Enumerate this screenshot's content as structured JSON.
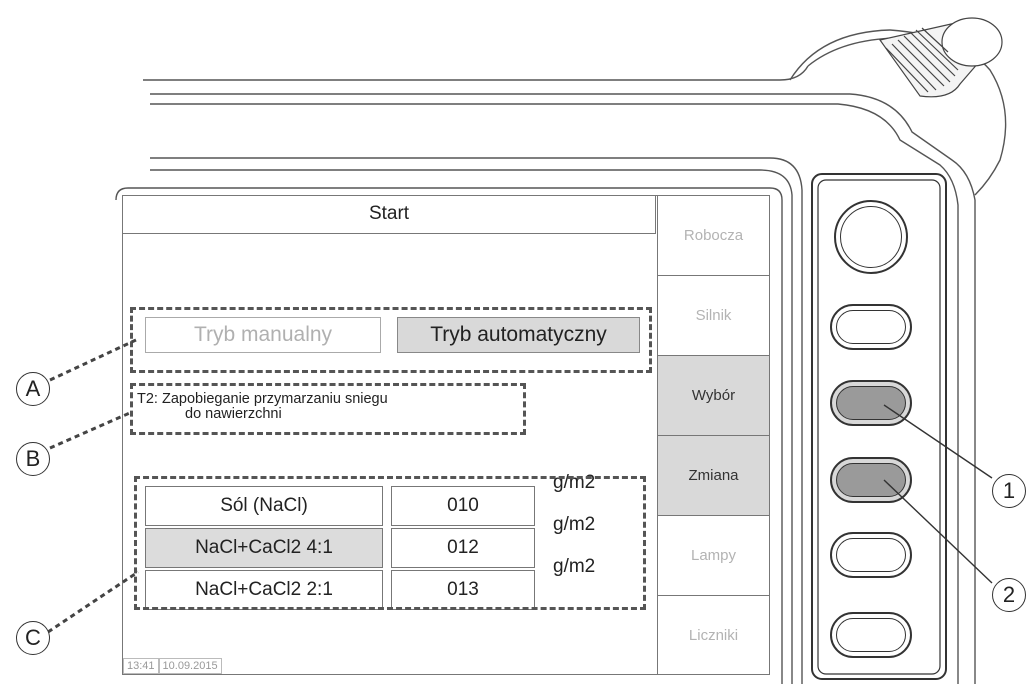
{
  "screen": {
    "title": "Start",
    "modes": {
      "manual": "Tryb manualny",
      "automatic": "Tryb automatyczny"
    },
    "description": {
      "line1": "T2: Zapobieganie przymarzaniu sniegu",
      "line2": "do nawierzchni"
    },
    "materials": [
      {
        "name": "Sól (NaCl)",
        "value": "010",
        "unit": "g/m2",
        "selected": false
      },
      {
        "name": "NaCl+CaCl2 4:1",
        "value": "012",
        "unit": "g/m2",
        "selected": true
      },
      {
        "name": "NaCl+CaCl2 2:1",
        "value": "013",
        "unit": "g/m2",
        "selected": false
      }
    ],
    "status": {
      "time": "13:41",
      "date": "10.09.2015"
    }
  },
  "side_tabs": [
    {
      "label": "Robocza",
      "active": false
    },
    {
      "label": "Silnik",
      "active": false
    },
    {
      "label": "Wybór",
      "active": true
    },
    {
      "label": "Zmiana",
      "active": true
    },
    {
      "label": "Lampy",
      "active": false
    },
    {
      "label": "Liczniki",
      "active": false
    }
  ],
  "callouts": {
    "a": "A",
    "b": "B",
    "c": "C",
    "one": "1",
    "two": "2"
  },
  "colors": {
    "active_fill": "#d9d9d9",
    "dash": "#555555",
    "pressed_button": "#9a9a9a"
  }
}
